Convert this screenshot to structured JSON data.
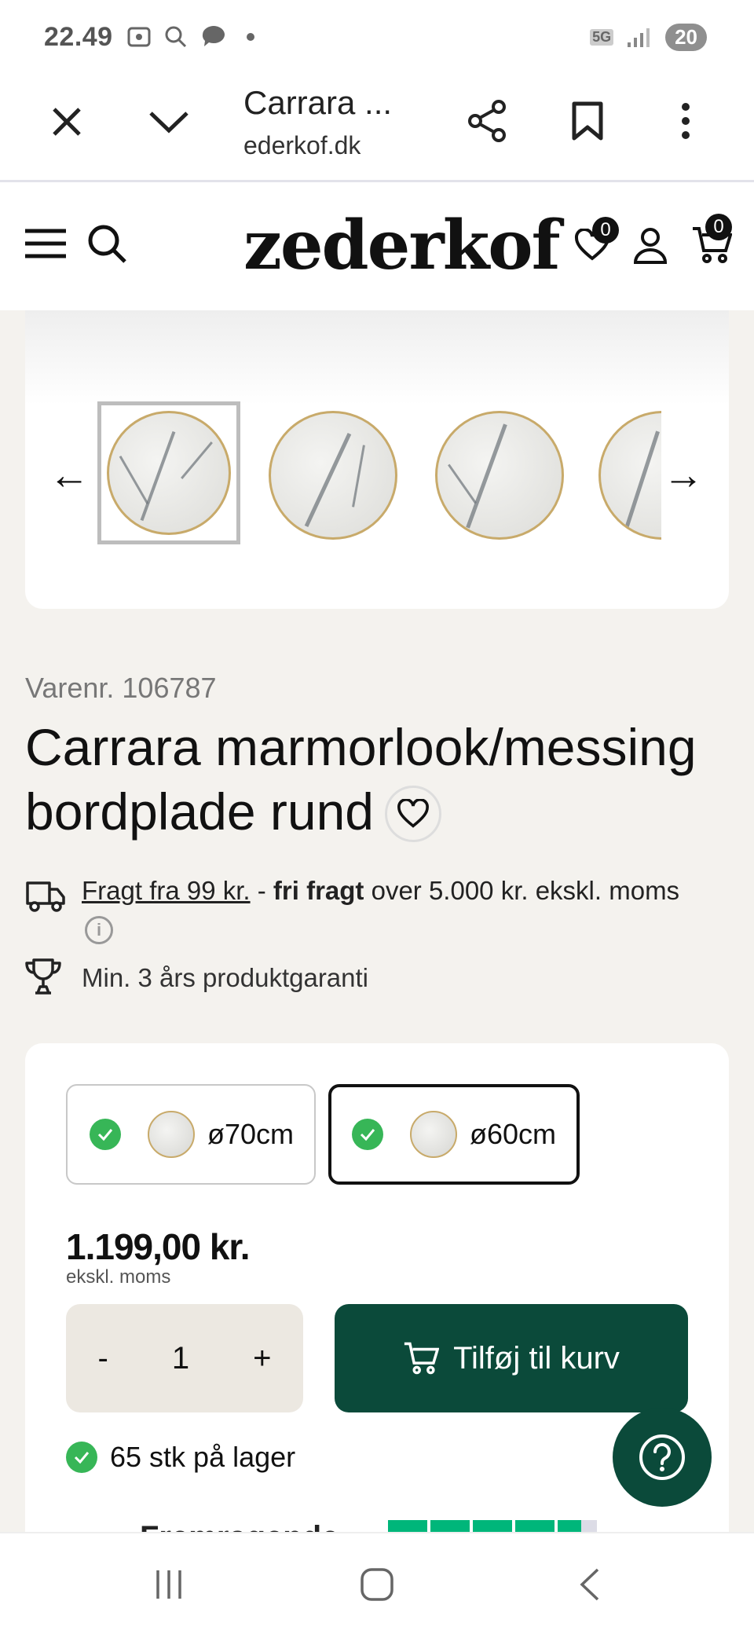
{
  "status_bar": {
    "time": "22.49",
    "network": "5G",
    "battery": "20"
  },
  "browser": {
    "title": "Carrara ...",
    "url": "ederkof.dk"
  },
  "site": {
    "logo": "zederkof",
    "wishlist_count": "0",
    "cart_count": "0"
  },
  "gallery": {
    "prev_arrow": "←",
    "next_arrow": "→"
  },
  "product": {
    "sku": "Varenr. 106787",
    "title_line1": "Carrara marmorlook/messing",
    "title_line2": "bordplade rund",
    "shipping_link": "Fragt fra 99 kr.",
    "shipping_sep": " - ",
    "shipping_bold": "fri fragt",
    "shipping_rest": " over 5.000 kr. ekskl. moms",
    "warranty": "Min. 3 års produktgaranti",
    "variants": [
      {
        "label": "ø70cm",
        "selected": false
      },
      {
        "label": "ø60cm",
        "selected": true
      }
    ],
    "price": "1.199,00 kr.",
    "price_note": "ekskl. moms",
    "quantity": "1",
    "qty_minus": "-",
    "qty_plus": "+",
    "add_to_cart": "Tilføj til kurv",
    "stock": "65 stk på lager"
  },
  "trustpilot": {
    "rating_text": "Fremragende",
    "stars": 4.5
  },
  "colors": {
    "brand_green": "#0b4a3a",
    "check_green": "#37b657",
    "trustpilot_green": "#00b67a",
    "page_bg": "#f4f2ee"
  }
}
